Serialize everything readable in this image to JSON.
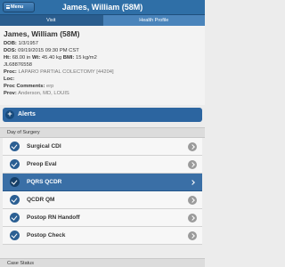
{
  "header": {
    "menu_label": "Menu",
    "title": "James, William (58M)"
  },
  "tabs": [
    {
      "label": "Visit"
    },
    {
      "label": "Health Profile"
    }
  ],
  "patient": {
    "name": "James, William (58M)",
    "dob_label": "DOB:",
    "dob": "1/3/1957",
    "dos_label": "DOS:",
    "dos": "09/19/2015 09:30 PM CST",
    "ht_label": "Ht:",
    "ht": "68.00 in",
    "wt_label": "Wt:",
    "wt": "45.40 kg",
    "bmi_label": "BMI:",
    "bmi": "15 kg/m2",
    "mrn": "JL68876558",
    "proc_label": "Proc:",
    "proc": "LAPARO PARTIAL COLECTOMY [44204]",
    "loc_label": "Loc:",
    "loc": "",
    "proc_comments_label": "Proc Comments:",
    "proc_comments": "erp",
    "prov_label": "Prov:",
    "prov": "Anderson, MD, LOUIS"
  },
  "alerts": {
    "label": "Alerts"
  },
  "day_section": {
    "label": "Day of Surgery"
  },
  "items": [
    {
      "label": "Surgical CDI"
    },
    {
      "label": "Preop Eval"
    },
    {
      "label": "PQRS QCDR"
    },
    {
      "label": "QCDR QM"
    },
    {
      "label": "Postop RN Handoff"
    },
    {
      "label": "Postop Check"
    }
  ],
  "case_status": {
    "label": "Case Status"
  },
  "colors": {
    "header_blue": "#2f6fa7",
    "selected_row": "#3a6fa6",
    "check_circle": "#2b5f93"
  },
  "icons": {
    "menu": "hamburger-icon",
    "alerts": "plus-icon",
    "item_status": "checkmark-icon",
    "item_nav": "chevron-right-icon"
  }
}
